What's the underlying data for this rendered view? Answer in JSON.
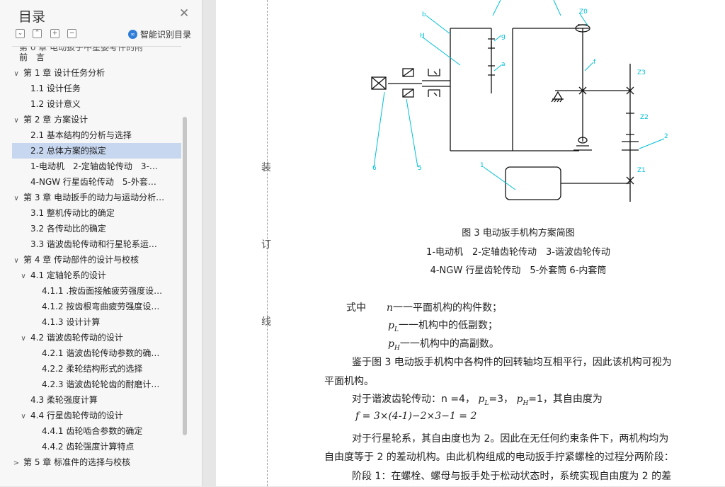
{
  "sidebar": {
    "title": "目录",
    "toolbar": {
      "collapse_all": "−",
      "expand_all": "+",
      "ai_toc_label": "智能识别目录"
    },
    "toc": [
      {
        "level": 1,
        "label": "第 0 章 电动扳手中星委考件的附",
        "arrow": "",
        "cut": true
      },
      {
        "level": 1,
        "label": "前　言",
        "arrow": ""
      },
      {
        "level": 1,
        "label": "第 1 章 设计任务分析",
        "arrow": "∨"
      },
      {
        "level": 2,
        "label": "1.1 设计任务",
        "arrow": ""
      },
      {
        "level": 2,
        "label": "1.2 设计意义",
        "arrow": ""
      },
      {
        "level": 1,
        "label": "第 2 章 方案设计",
        "arrow": "∨"
      },
      {
        "level": 2,
        "label": "2.1 基本结构的分析与选择",
        "arrow": ""
      },
      {
        "level": 2,
        "label": "2.2 总体方案的拟定",
        "arrow": "",
        "selected": true
      },
      {
        "level": 2,
        "label": "1-电动机　2-定轴齿轮传动　3-…",
        "arrow": ""
      },
      {
        "level": 2,
        "label": "4-NGW 行星齿轮传动　5-外套…",
        "arrow": ""
      },
      {
        "level": 1,
        "label": "第 3 章 电动扳手的动力与运动分析…",
        "arrow": "∨"
      },
      {
        "level": 2,
        "label": "3.1 整机传动比的确定",
        "arrow": ""
      },
      {
        "level": 2,
        "label": "3.2 各传动比的确定",
        "arrow": ""
      },
      {
        "level": 2,
        "label": "3.3 谐波齿轮传动和行星轮系运…",
        "arrow": ""
      },
      {
        "level": 1,
        "label": "第 4 章 传动部件的设计与校核",
        "arrow": "∨"
      },
      {
        "level": 2,
        "label": "4.1 定轴轮系的设计",
        "arrow": "∨"
      },
      {
        "level": 3,
        "label": "4.1.1 .按齿面接触疲劳强度设…",
        "arrow": ""
      },
      {
        "level": 3,
        "label": "4.1.2 按齿根弯曲疲劳强度设…",
        "arrow": ""
      },
      {
        "level": 3,
        "label": "4.1.3 设计计算",
        "arrow": ""
      },
      {
        "level": 2,
        "label": "4.2 谐波齿轮传动的设计",
        "arrow": "∨"
      },
      {
        "level": 3,
        "label": "4.2.1 谐波齿轮传动参数的确…",
        "arrow": ""
      },
      {
        "level": 3,
        "label": "4.2.2 柔轮结构形式的选择",
        "arrow": ""
      },
      {
        "level": 3,
        "label": "4.2.3 谐波齿轮轮齿的耐磨计…",
        "arrow": ""
      },
      {
        "level": 2,
        "label": "4.3 柔轮强度计算",
        "arrow": ""
      },
      {
        "level": 2,
        "label": "4.4 行星齿轮传动的设计",
        "arrow": "∨"
      },
      {
        "level": 3,
        "label": "4.4.1 齿轮啮合参数的确定",
        "arrow": ""
      },
      {
        "level": 3,
        "label": "4.4.2 齿轮强度计算特点",
        "arrow": ""
      },
      {
        "level": 1,
        "label": "第 5 章 标准件的选择与校核",
        "arrow": ">"
      }
    ]
  },
  "document": {
    "margin_chars": [
      "装",
      "订",
      "线"
    ],
    "figure_labels": {
      "b": "b",
      "H": "H",
      "g": "g",
      "a": "a",
      "f": "f",
      "Z0": "Z0",
      "Z3": "Z3",
      "Z2": "Z2",
      "Z1": "Z1",
      "n1": "1",
      "n2": "2",
      "n5": "5",
      "n6": "6"
    },
    "caption_title": "图 3 电动扳手机构方案简图",
    "caption_line1": "1-电动机　2-定轴齿轮传动　3-谐波齿轮传动",
    "caption_line2": "4-NGW 行星齿轮传动　5-外套筒 6-内套筒",
    "formula_intro": "式中",
    "n_sym": "n",
    "n_desc": "一一平面机构的构件数；",
    "pl_sym": "p",
    "pl_sub": "L",
    "pl_desc": "一一机构中的低副数；",
    "ph_sym": "p",
    "ph_sub": "H",
    "ph_desc": "一一机构中的高副数。",
    "para1_line1": "鉴于图 3 电动扳手机构中各构件的回转轴均互相平行，因此该机构可视为",
    "para1_line2": "平面机构。",
    "harmonic_text": "对于谐波齿轮传动：n =4，",
    "harmonic_pl": "=3，",
    "harmonic_ph": "=1，其自由度为",
    "dof_formula": "f = 3×(4-1)−2×3−1 = 2",
    "para2_line1": "对于行星轮系，其自由度也为 2。因此在无任何约束条件下，两机构均为",
    "para2_line2": "自由度等于 2 的差动机构。由此机构组成的电动扳手拧紧螺栓的过程分两阶段：",
    "para3_line1": "阶段 1：在螺栓、螺母与扳手处于松动状态时，系统实现自由度为 2 的差"
  }
}
